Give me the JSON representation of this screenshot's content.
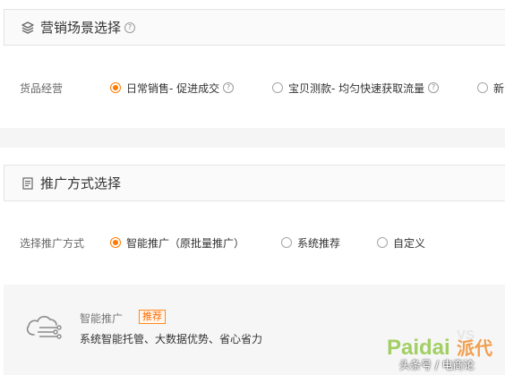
{
  "scene_section": {
    "title": "营销场景选择",
    "help": "?",
    "label": "货品经营",
    "options": [
      {
        "label": "日常销售- 促进成交",
        "checked": true,
        "has_help": true
      },
      {
        "label": "宝贝测款- 均匀快速获取流量",
        "checked": false,
        "has_help": true
      },
      {
        "label": "新",
        "checked": false,
        "has_help": false
      }
    ]
  },
  "promo_section": {
    "title": "推广方式选择",
    "label": "选择推广方式",
    "options": [
      {
        "label": "智能推广（原批量推广）",
        "checked": true
      },
      {
        "label": "系统推荐",
        "checked": false
      },
      {
        "label": "自定义",
        "checked": false
      }
    ]
  },
  "info_panel": {
    "icon": "cloud-circuit-icon",
    "title": "智能推广",
    "badge": "推荐",
    "description": "系统智能托管、大数据优势、省心省力"
  },
  "watermark": {
    "logo_text_main": "Paidai",
    "logo_text_cn": "派代",
    "logo_text_vs": "VS",
    "caption": "头条号 / 电商论"
  },
  "colors": {
    "accent": "#ff7a00",
    "logo_green": "#8cc63f",
    "logo_orange": "#f08a24"
  }
}
